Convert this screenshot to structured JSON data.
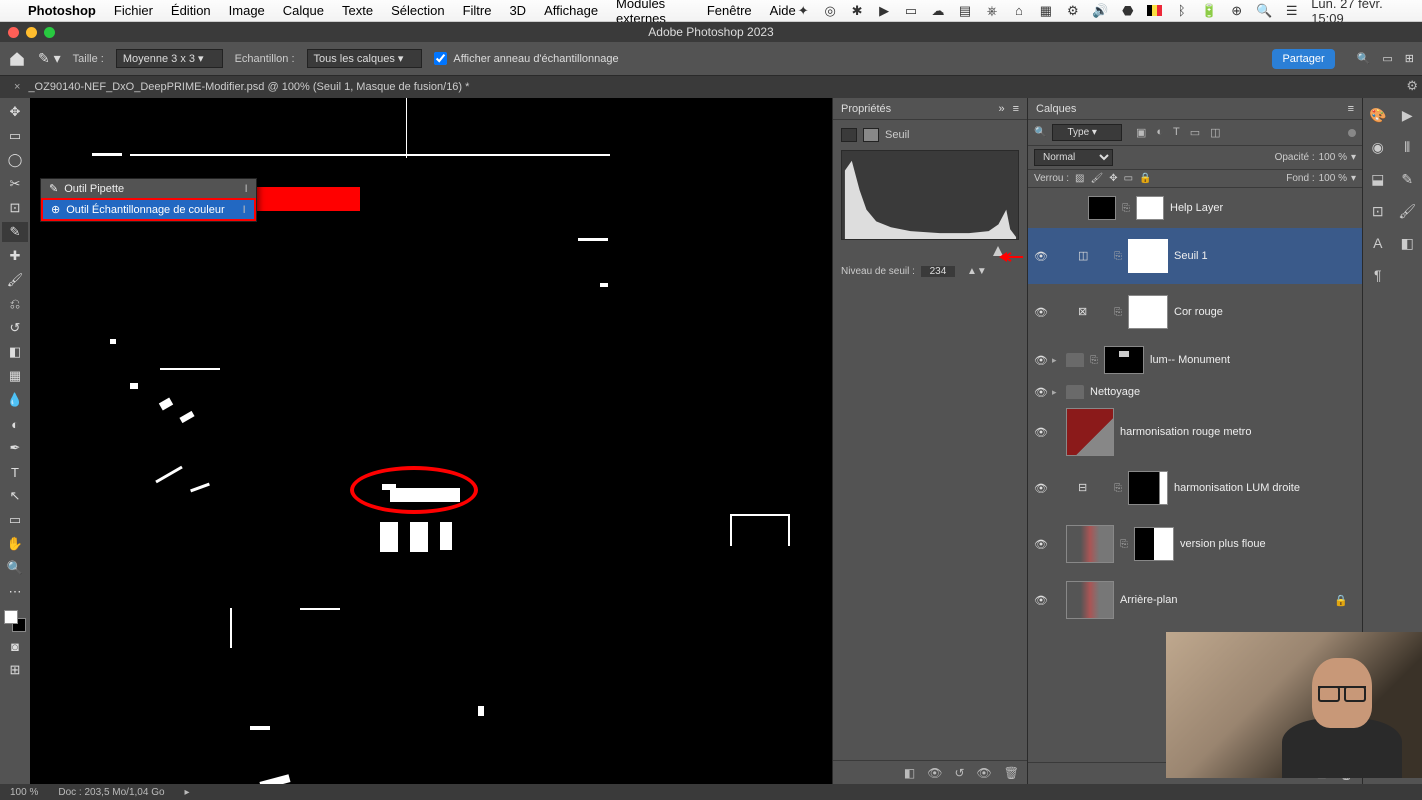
{
  "mac_menu": {
    "app": "Photoshop",
    "items": [
      "Fichier",
      "Édition",
      "Image",
      "Calque",
      "Texte",
      "Sélection",
      "Filtre",
      "3D",
      "Affichage",
      "Modules externes",
      "Fenêtre",
      "Aide"
    ],
    "datetime": "Lun. 27 févr. 15:09"
  },
  "window_title": "Adobe Photoshop 2023",
  "options": {
    "taille_label": "Taille :",
    "taille_value": "Moyenne 3 x 3",
    "echant_label": "Echantillon :",
    "echant_value": "Tous les calques",
    "afficher_anneau": "Afficher anneau d'échantillonnage",
    "share": "Partager"
  },
  "doc_tab": "_OZ90140-NEF_DxO_DeepPRIME-Modifier.psd @ 100% (Seuil 1, Masque de fusion/16) *",
  "tool_flyout": {
    "items": [
      {
        "label": "Outil Pipette",
        "key": "I"
      },
      {
        "label": "Outil Échantillonnage de couleur",
        "key": "I"
      }
    ]
  },
  "properties": {
    "title": "Propriétés",
    "adj_label": "Seuil",
    "level_label": "Niveau de seuil :",
    "level_value": "234"
  },
  "layers_panel": {
    "title": "Calques",
    "filter_label": "Type",
    "blend_mode": "Normal",
    "opacity_label": "Opacité :",
    "opacity_value": "100 %",
    "lock_label": "Verrou :",
    "fill_label": "Fond :",
    "fill_value": "100 %",
    "layers": [
      {
        "name": "Help Layer"
      },
      {
        "name": "Seuil 1"
      },
      {
        "name": "Cor rouge"
      },
      {
        "name": "lum-- Monument"
      },
      {
        "name": "Nettoyage"
      },
      {
        "name": "harmonisation rouge metro"
      },
      {
        "name": "harmonisation LUM droite"
      },
      {
        "name": "version plus floue"
      },
      {
        "name": "Arrière-plan"
      }
    ]
  },
  "status": {
    "zoom": "100 %",
    "doc": "Doc : 203,5 Mo/1,04 Go"
  }
}
